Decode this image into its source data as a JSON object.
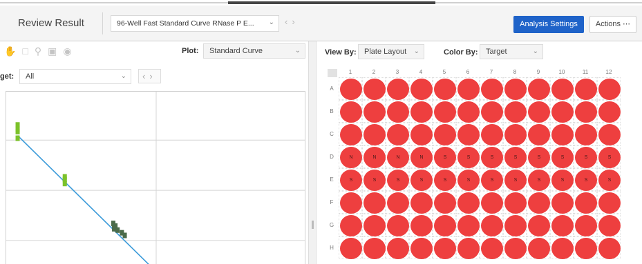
{
  "header": {
    "title": "Review Result",
    "experiment": "96-Well Fast Standard Curve RNase P E...",
    "analysis_settings": "Analysis Settings",
    "actions": "Actions ⋯"
  },
  "left_panel": {
    "plot_label": "Plot:",
    "plot_value": "Standard Curve",
    "target_label": "get:",
    "target_value": "All",
    "icons": [
      "hand-icon",
      "select-icon",
      "zoom-icon",
      "save-icon",
      "eye-icon"
    ]
  },
  "right_panel": {
    "view_by_label": "View By:",
    "view_by_value": "Plate Layout",
    "color_by_label": "Color By:",
    "color_by_value": "Target"
  },
  "plate": {
    "columns": [
      "1",
      "2",
      "3",
      "4",
      "5",
      "6",
      "7",
      "8",
      "9",
      "10",
      "11",
      "12"
    ],
    "rows": [
      "A",
      "B",
      "C",
      "D",
      "E",
      "F",
      "G",
      "H"
    ],
    "well_color": "#ee3f3f",
    "labels": {
      "D": [
        "N",
        "N",
        "N",
        "N",
        "S",
        "S",
        "S",
        "S",
        "S",
        "S",
        "S",
        "S"
      ],
      "E": [
        "S",
        "S",
        "S",
        "S",
        "S",
        "S",
        "S",
        "S",
        "S",
        "S",
        "S",
        "S"
      ]
    }
  },
  "chart_data": {
    "type": "scatter",
    "title": "",
    "xlabel": "",
    "ylabel": "",
    "series": [
      {
        "values": [
          [
            -0.4,
            9.5
          ],
          [
            -0.4,
            9.2
          ],
          [
            -0.4,
            9.0
          ],
          [
            -0.4,
            8.5
          ]
        ],
        "color": "#7cc22a"
      },
      {
        "values": [
          [
            6.2,
            5.6
          ],
          [
            6.2,
            5.4
          ],
          [
            6.2,
            5.1
          ]
        ],
        "color": "#7cc22a"
      },
      {
        "values": [
          [
            13.0,
            2.1
          ],
          [
            13.3,
            1.9
          ],
          [
            13.1,
            1.7
          ],
          [
            13.6,
            1.6
          ],
          [
            14.2,
            1.4
          ],
          [
            14.6,
            1.2
          ]
        ],
        "color": "#4a6b4a"
      }
    ],
    "fit_line": {
      "x": [
        -0.4,
        18
      ],
      "y": [
        8.7,
        -1.0
      ],
      "color": "#3a9ad9"
    },
    "xlim": [
      -2,
      40
    ],
    "ylim": [
      -1,
      12
    ],
    "grid": true
  }
}
